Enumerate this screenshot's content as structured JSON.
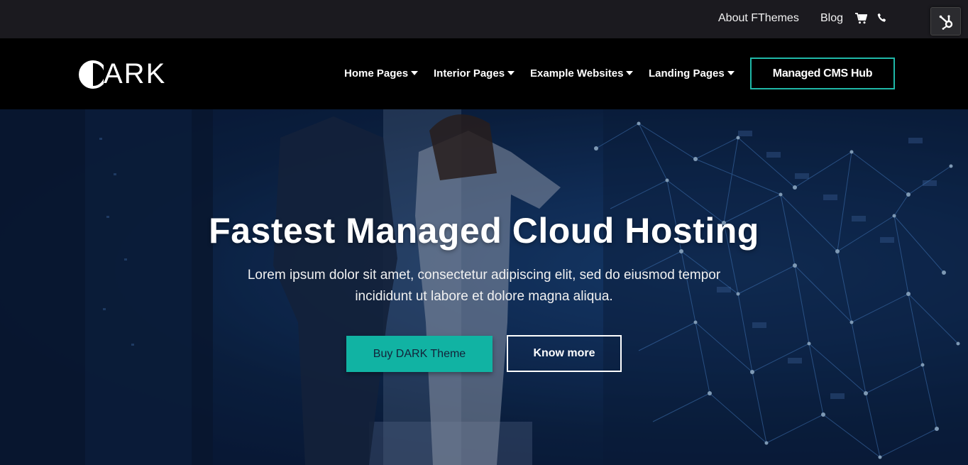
{
  "topbar": {
    "about_label": "About FThemes",
    "blog_label": "Blog",
    "cart_icon": "cart-icon",
    "phone_icon": "phone-icon",
    "hub_icon": "hubspot-icon"
  },
  "header": {
    "logo_text": "ARK",
    "logo_alt": "DARK",
    "nav": [
      {
        "label": "Home Pages"
      },
      {
        "label": "Interior Pages"
      },
      {
        "label": "Example Websites"
      },
      {
        "label": "Landing Pages"
      }
    ],
    "cta_label": "Managed CMS Hub"
  },
  "hero": {
    "title": "Fastest Managed Cloud Hosting",
    "subtitle": "Lorem ipsum dolor sit amet, consectetur adipiscing elit, sed do eiusmod tempor incididunt ut labore et dolore magna aliqua.",
    "primary_button": "Buy DARK Theme",
    "secondary_button": "Know more"
  },
  "colors": {
    "accent": "#11b3a3",
    "topbar_bg": "#1b1a1f",
    "header_bg": "#000000",
    "hero_blue": "#153a6c"
  }
}
